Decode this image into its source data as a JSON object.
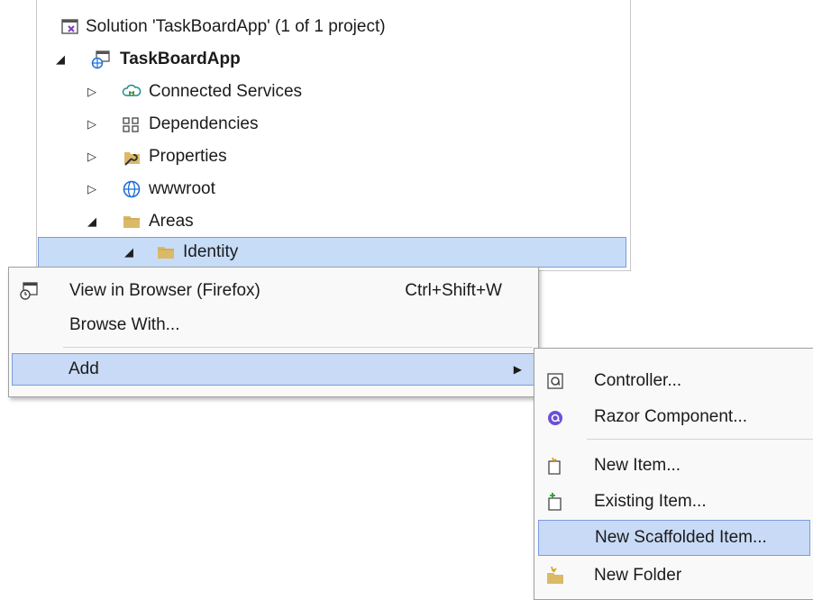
{
  "tree": {
    "solution_label": "Solution 'TaskBoardApp' (1 of 1 project)",
    "project_label": "TaskBoardApp",
    "items": [
      {
        "label": "Connected Services",
        "icon": "connected-services-icon"
      },
      {
        "label": "Dependencies",
        "icon": "dependencies-icon"
      },
      {
        "label": "Properties",
        "icon": "properties-icon"
      },
      {
        "label": "wwwroot",
        "icon": "globe-icon"
      },
      {
        "label": "Areas",
        "icon": "folder-icon"
      },
      {
        "label": "Identity",
        "icon": "folder-icon"
      }
    ]
  },
  "context_menu": {
    "view_in_browser": {
      "label": "View in Browser (Firefox)",
      "shortcut": "Ctrl+Shift+W"
    },
    "browse_with": {
      "label": "Browse With..."
    },
    "add": {
      "label": "Add"
    }
  },
  "add_submenu": {
    "items": [
      {
        "label": "Controller...",
        "icon": "controller-icon"
      },
      {
        "label": "Razor Component...",
        "icon": "razor-icon"
      },
      {
        "label": "New Item...",
        "icon": "new-item-icon"
      },
      {
        "label": "Existing Item...",
        "icon": "existing-item-icon"
      },
      {
        "label": "New Scaffolded Item...",
        "icon": ""
      },
      {
        "label": "New Folder",
        "icon": "new-folder-icon"
      }
    ]
  },
  "colors": {
    "selection": "#c8daf5",
    "selection_border": "#7a9be0",
    "folder": "#dcb967",
    "accent": "#1e6fd9"
  }
}
